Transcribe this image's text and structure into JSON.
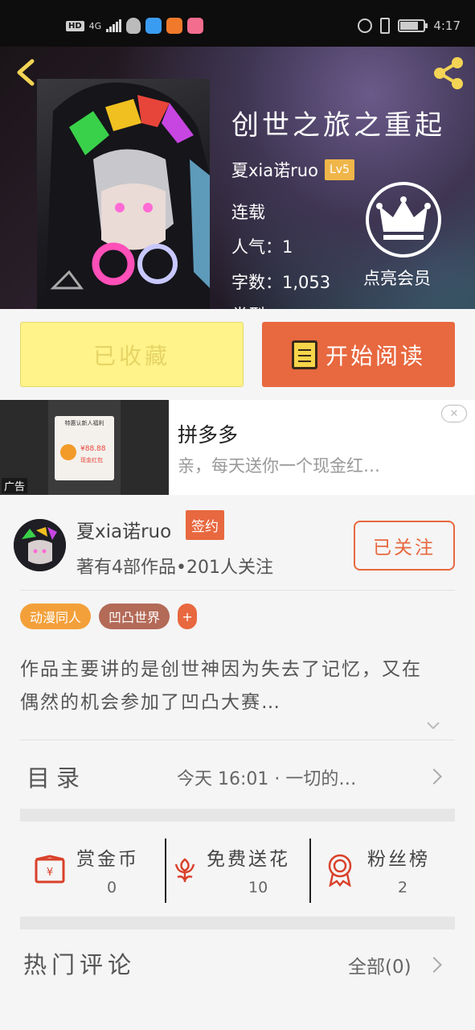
{
  "status_bar": {
    "hd_badge": "HD",
    "network": "4G",
    "time": "4:17"
  },
  "header": {
    "book_title": "创世之旅之重起",
    "author": "夏xia诺ruo",
    "level": "Lv5",
    "status": "连载",
    "popularity": "人气：1",
    "word_count": "字数：1,053",
    "partial_line": "类型：",
    "vip_label": "点亮会员"
  },
  "actions": {
    "collected_label": "已收藏",
    "read_label": "开始阅读"
  },
  "ad": {
    "title": "拼多多",
    "desc": "亲，每天送你一个现金红…",
    "label": "广告",
    "card_title": "特惠认新人福利",
    "card_amount": "¥88.88",
    "card_sub": "现金红包",
    "close": "✕"
  },
  "author_section": {
    "name": "夏xia诺ruo",
    "sign_badge": "签约",
    "stats": "著有4部作品•201人关注",
    "follow_label": "已关注"
  },
  "tags": [
    "动漫同人",
    "凹凸世界"
  ],
  "tag_add": "+",
  "description": "作品主要讲的是创世神因为失去了记忆，又在偶然的机会参加了凹凸大赛…",
  "catalog": {
    "title": "目录",
    "latest": "今天 16:01 · 一切的…"
  },
  "stats": [
    {
      "label": "赏金币",
      "value": "0",
      "icon": "reward-coin-icon"
    },
    {
      "label": "免费送花",
      "value": "10",
      "icon": "flower-icon"
    },
    {
      "label": "粉丝榜",
      "value": "2",
      "icon": "medal-icon"
    }
  ],
  "comments": {
    "title": "热门评论",
    "all_label": "全部(0)"
  },
  "colors": {
    "accent": "#e8683f",
    "collected_bg": "#fff389",
    "tag_orange": "#f3a03a",
    "tag_brown": "#b36a57",
    "level_badge": "#f0b64a"
  }
}
